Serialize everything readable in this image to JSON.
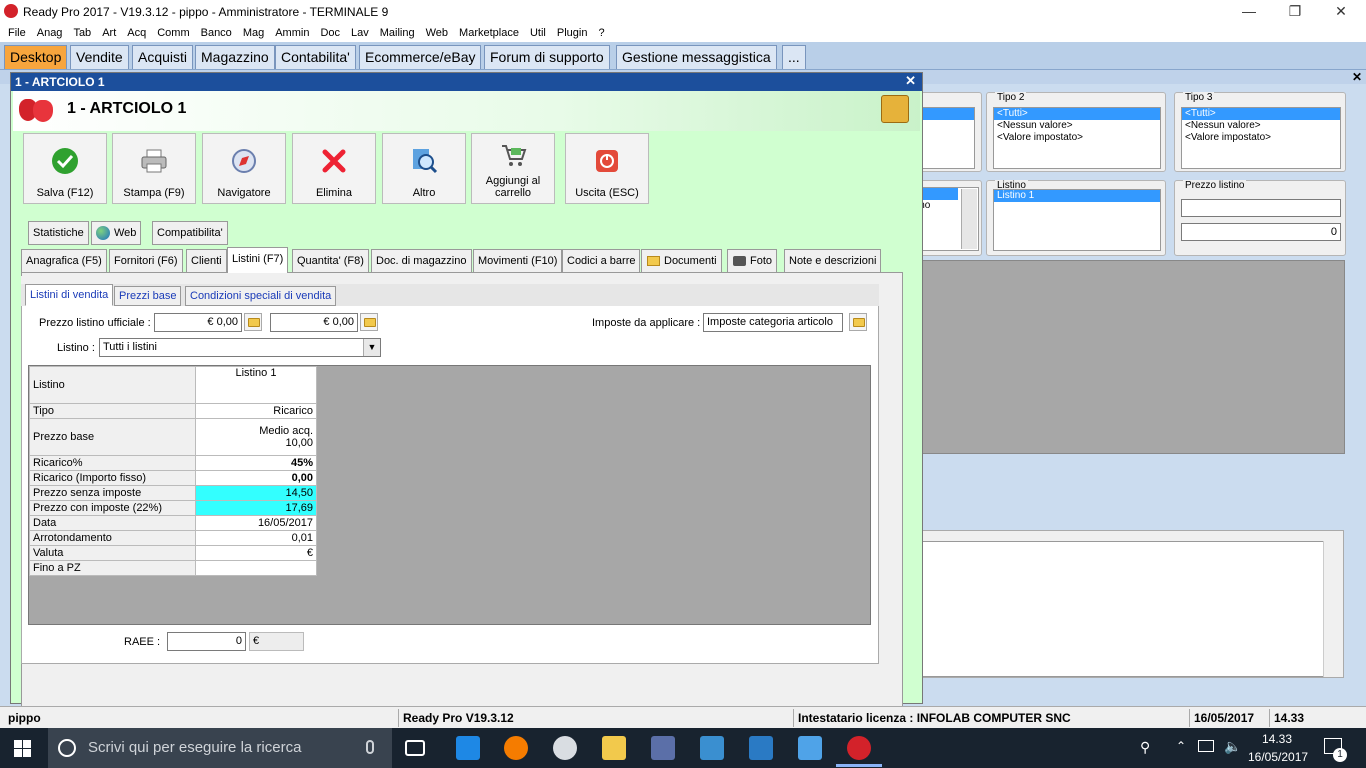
{
  "window": {
    "title": "Ready Pro 2017 - V19.3.12 - pippo - Amministratore - TERMINALE 9"
  },
  "menu": [
    "File",
    "Anag",
    "Tab",
    "Art",
    "Acq",
    "Comm",
    "Banco",
    "Mag",
    "Ammin",
    "Doc",
    "Lav",
    "Mailing",
    "Web",
    "Marketplace",
    "Util",
    "Plugin",
    "?"
  ],
  "main_tabs": [
    "Desktop",
    "Vendite",
    "Acquisti",
    "Magazzino",
    "Contabilita'",
    "Ecommerce/eBay",
    "Forum di supporto",
    "Gestione messaggistica",
    "..."
  ],
  "bg_filters": {
    "tipo2": {
      "label": "Tipo 2",
      "items": [
        "<Tutti>",
        "<Nessun valore>",
        "<Valore impostato>"
      ]
    },
    "tipo3": {
      "label": "Tipo 3",
      "items": [
        "<Tutti>",
        "<Nessun valore>",
        "<Valore impostato>"
      ]
    },
    "listino": {
      "label": "Listino",
      "items": [
        "Listino 1"
      ]
    },
    "prezzo_listino": {
      "label": "Prezzo listino",
      "value": "0"
    },
    "partial_text": "ino"
  },
  "dialog": {
    "title": "1 - ARTCIOLO 1",
    "header_title": "1 - ARTCIOLO 1",
    "toolbar": {
      "salva": "Salva (F12)",
      "stampa": "Stampa (F9)",
      "navigatore": "Navigatore",
      "elimina": "Elimina",
      "altro": "Altro",
      "carrello": "Aggiungi al carrello",
      "uscita": "Uscita (ESC)"
    },
    "tabs_row1": [
      "Statistiche",
      "Web",
      "Compatibilita'"
    ],
    "tabs_row2": [
      "Anagrafica (F5)",
      "Fornitori (F6)",
      "Clienti",
      "Listini (F7)",
      "Quantita' (F8)",
      "Doc. di magazzino",
      "Movimenti (F10)",
      "Codici a barre",
      "Documenti",
      "Foto",
      "Note e descrizioni"
    ],
    "subtabs": [
      "Listini di vendita",
      "Prezzi base",
      "Condizioni speciali di vendita"
    ],
    "prezzo_label": "Prezzo listino ufficiale :",
    "prezzo_val1": "€ 0,00",
    "prezzo_val2": "€ 0,00",
    "imposte_label": "Imposte da applicare :",
    "imposte_value": "Imposte categoria articolo",
    "listino_label": "Listino :",
    "listino_value": "Tutti i listini",
    "grid": {
      "header_label": "Listino",
      "header_col": "Listino 1",
      "rows": [
        {
          "label": "Tipo",
          "value": "Ricarico"
        },
        {
          "label": "Prezzo base",
          "value": "Medio acq.",
          "value2": "10,00"
        },
        {
          "label": "Ricarico%",
          "value": "45%"
        },
        {
          "label": "Ricarico (Importo fisso)",
          "value": "0,00"
        },
        {
          "label": "Prezzo senza imposte",
          "value": "14,50"
        },
        {
          "label": "Prezzo con imposte (22%)",
          "value": "17,69"
        },
        {
          "label": "Data",
          "value": "16/05/2017"
        },
        {
          "label": "Arrotondamento",
          "value": "0,01"
        },
        {
          "label": "Valuta",
          "value": "€"
        },
        {
          "label": "Fino a PZ",
          "value": ""
        }
      ]
    },
    "raee_label": "RAEE :",
    "raee_value": "0",
    "raee_currency": "€"
  },
  "status": {
    "user": "pippo",
    "version": "Ready Pro V19.3.12",
    "license": "Intestatario licenza : INFOLAB COMPUTER SNC",
    "date": "16/05/2017",
    "time": "14.33"
  },
  "taskbar": {
    "search_placeholder": "Scrivi qui per eseguire la ricerca",
    "clock_time": "14.33",
    "clock_date": "16/05/2017",
    "notif_count": "1"
  },
  "colors": {
    "accent_tab": "#f7a53d",
    "dialog_bg": "#d0ffd0",
    "title_bar": "#1c4f9c",
    "highlight_cell": "#33ffff"
  }
}
